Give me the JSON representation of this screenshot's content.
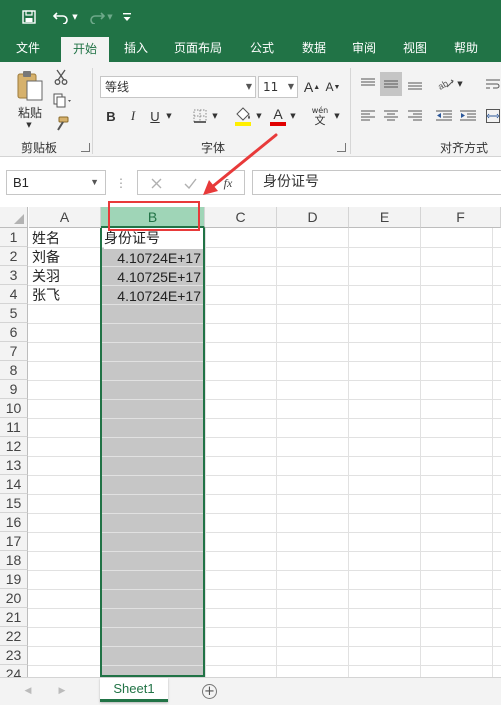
{
  "titlebar": {
    "icons": [
      "save-icon",
      "undo-icon",
      "redo-icon",
      "customize-icon"
    ],
    "accent_color": "#217346"
  },
  "tabs": [
    {
      "label": "文件",
      "active": false
    },
    {
      "label": "开始",
      "active": true
    },
    {
      "label": "插入",
      "active": false
    },
    {
      "label": "页面布局",
      "active": false
    },
    {
      "label": "公式",
      "active": false
    },
    {
      "label": "数据",
      "active": false
    },
    {
      "label": "审阅",
      "active": false
    },
    {
      "label": "视图",
      "active": false
    },
    {
      "label": "帮助",
      "active": false
    }
  ],
  "ribbon": {
    "paste_label": "粘贴",
    "clipboard_group": "剪贴板",
    "font_name": "等线",
    "font_size": "11",
    "font_group": "字体",
    "align_group": "对齐方式",
    "bold": "B",
    "italic": "I",
    "underline": "U",
    "font_color_glyph": "A",
    "wen_glyph": "wén",
    "wen_sub": "文"
  },
  "formula_bar": {
    "name_box": "B1",
    "fx_label": "fx",
    "value": "身份证号"
  },
  "grid": {
    "columns": [
      "A",
      "B",
      "C",
      "D",
      "E",
      "F"
    ],
    "selected_column": "B",
    "row_numbers": [
      "1",
      "2",
      "3",
      "4",
      "5",
      "6",
      "7",
      "8",
      "9",
      "10",
      "11",
      "12",
      "13",
      "14",
      "15",
      "16",
      "17",
      "18",
      "19",
      "20",
      "21",
      "22",
      "23",
      "24"
    ],
    "cells": {
      "A1": "姓名",
      "B1": "身份证号",
      "A2": "刘备",
      "B2": "4.10724E+17",
      "A3": "关羽",
      "B3": "4.10725E+17",
      "A4": "张飞",
      "B4": "4.10724E+17"
    }
  },
  "sheets": [
    {
      "name": "Sheet1",
      "active": true
    }
  ],
  "add_sheet_glyph": "+",
  "annotation_color": "#e83a3a",
  "selection_color": "#217346"
}
